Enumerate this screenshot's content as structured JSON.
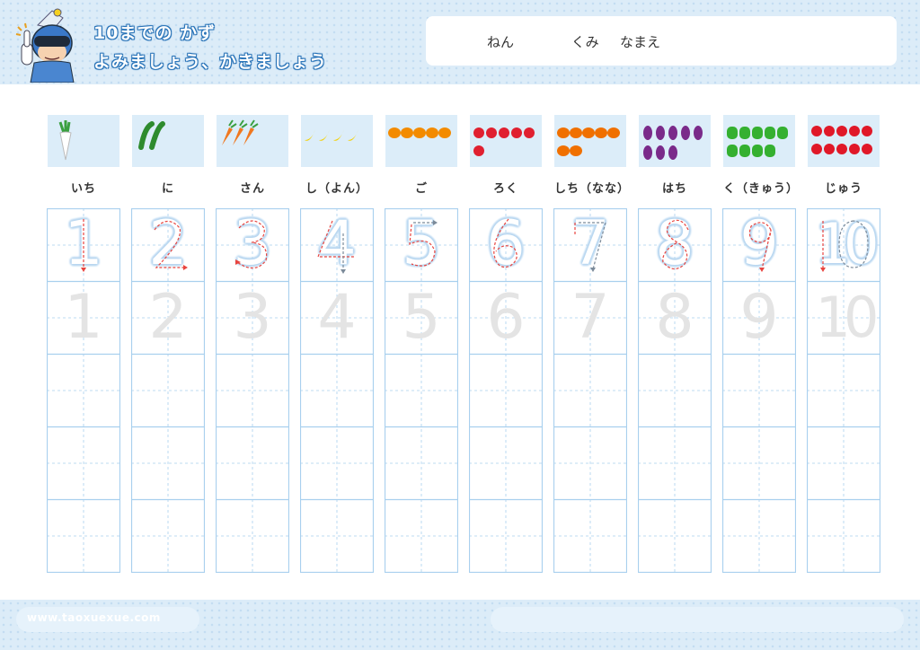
{
  "header": {
    "title_line1": "10までの かず",
    "title_line2": "よみましょう、かきましょう",
    "mascot_icon": "hero-mascot-icon"
  },
  "name_box": {
    "nen_label": "ねん",
    "kumi_label": "くみ",
    "namae_label": "なまえ"
  },
  "colors": {
    "grid_blue": "#a9d0ee",
    "band_blue": "#dcecf8",
    "guide_red": "#e8443f",
    "guide_gray": "#7b8a99"
  },
  "columns": [
    {
      "numeral": "1",
      "reading": "いち",
      "count": 1,
      "item_icon": "daikon-icon",
      "item_color": "#ffffff"
    },
    {
      "numeral": "2",
      "reading": "に",
      "count": 2,
      "item_icon": "green-bean-icon",
      "item_color": "#2e8b2e"
    },
    {
      "numeral": "3",
      "reading": "さん",
      "count": 3,
      "item_icon": "carrot-icon",
      "item_color": "#f07820"
    },
    {
      "numeral": "4",
      "reading": "し（よん）",
      "count": 4,
      "item_icon": "banana-icon",
      "item_color": "#f5d000"
    },
    {
      "numeral": "5",
      "reading": "ご",
      "count": 5,
      "item_icon": "orange-icon",
      "item_color": "#f38b00"
    },
    {
      "numeral": "6",
      "reading": "ろく",
      "count": 6,
      "item_icon": "apple-icon",
      "item_color": "#e02030"
    },
    {
      "numeral": "7",
      "reading": "しち（なな）",
      "count": 7,
      "item_icon": "pumpkin-icon",
      "item_color": "#f07000"
    },
    {
      "numeral": "8",
      "reading": "はち",
      "count": 8,
      "item_icon": "eggplant-icon",
      "item_color": "#7a2a8a"
    },
    {
      "numeral": "9",
      "reading": "く（きゅう）",
      "count": 9,
      "item_icon": "green-pepper-icon",
      "item_color": "#35b030"
    },
    {
      "numeral": "10",
      "reading": "じゅう",
      "count": 10,
      "item_icon": "tomato-icon",
      "item_color": "#e01828"
    }
  ],
  "footer": {
    "url": "www.taoxuexue.com"
  }
}
